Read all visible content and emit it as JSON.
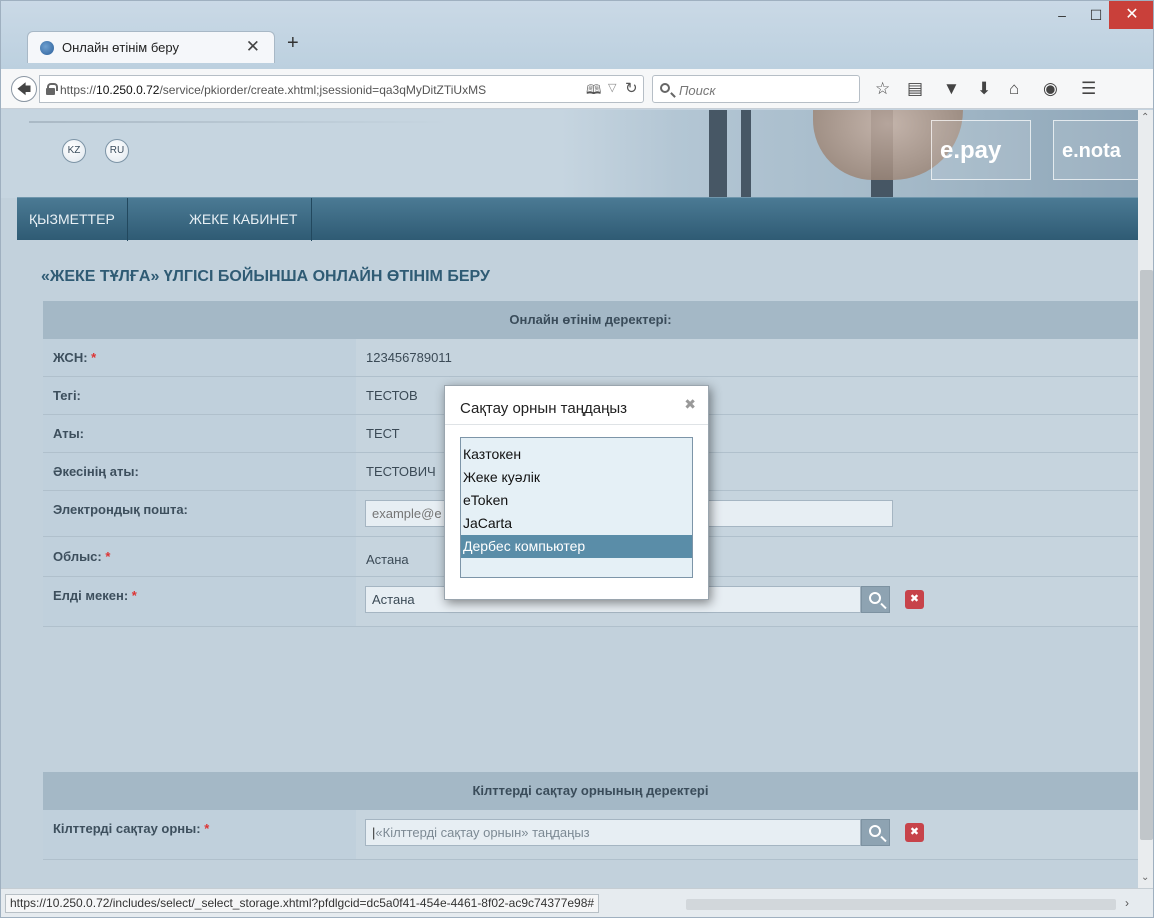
{
  "browser": {
    "tab_title": "Онлайн өтінім беру",
    "tab_close": "✕",
    "new_tab": "+",
    "url_prefix": "https://",
    "url_host": "10.250.0.72",
    "url_path": "/service/pkiorder/create.xhtml;jsessionid=qa3qMyDitZTiUxMS",
    "search_placeholder": "Поиск",
    "status_url": "https://10.250.0.72/includes/select/_select_storage.xhtml?pfdlgcid=dc5a0f41-454e-4461-8f02-ac9c74377e98#"
  },
  "icons": {
    "back": "back-arrow-icon",
    "lock": "lock-icon",
    "reader": "reader-view-icon",
    "reload": "reload-icon",
    "star": "bookmark-star-icon",
    "clipboard": "bookmarks-list-icon",
    "pocket": "pocket-icon",
    "download": "download-icon",
    "home": "home-icon",
    "chat": "chat-icon",
    "menu": "hamburger-menu-icon",
    "search": "magnifier-icon",
    "clear": "clear-x-icon"
  },
  "header": {
    "lang_kz": "KZ",
    "lang_ru": "RU",
    "brand_pay": "e.pay",
    "brand_nota": "e.nota"
  },
  "menu": {
    "services": "ҚЫЗМЕТТЕР",
    "cabinet": "ЖЕКЕ КАБИНЕТ"
  },
  "page": {
    "title": "«ЖЕКЕ ТҰЛҒА» ҮЛГІСІ БОЙЫНША ОНЛАЙН ӨТІНІМ БЕРУ"
  },
  "section1": {
    "header": "Онлайн өтінім деректері:",
    "iin_label": "ЖСН:",
    "iin_value": "123456789011",
    "surname_label": "Тегі:",
    "surname_value": "ТЕСТОВ",
    "name_label": "Аты:",
    "name_value": "ТЕСТ",
    "patronymic_label": "Әкесінің аты:",
    "patronymic_value": "ТЕСТОВИЧ",
    "email_label": "Электрондық пошта:",
    "email_placeholder": "example@e",
    "region_label": "Облыс:",
    "region_value": "Астана",
    "locality_label": "Елді мекен:",
    "locality_value": "Астана",
    "required_mark": "*"
  },
  "section2": {
    "header": "Кілттерді сақтау орнының деректері",
    "storage_label": "Кілттерді сақтау орны:",
    "storage_placeholder": "«Кілттерді сақтау орнын» таңдаңыз",
    "required_mark": "*"
  },
  "modal": {
    "title": "Сақтау орнын таңдаңыз",
    "close": "✖",
    "options": [
      "Казтокен",
      "Жеке куәлік",
      "eToken",
      "JaCarta",
      "Дербес компьютер"
    ],
    "selected": "Дербес компьютер"
  },
  "colors": {
    "menubar": "#3a6781",
    "title": "#2f5b74",
    "selected_option": "#5a8da8",
    "clear_button": "#c7434a",
    "required": "#dd3333"
  }
}
